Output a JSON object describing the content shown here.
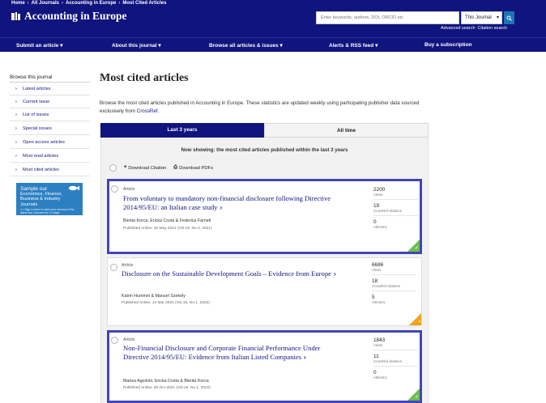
{
  "breadcrumb": [
    "Home",
    "All Journals",
    "Accounting in Europe",
    "Most Cited Articles"
  ],
  "journal": {
    "title": "Accounting in Europe"
  },
  "search": {
    "placeholder": "Enter keywords, authors, DOI, ORCID etc",
    "scope": "This Journal",
    "advanced": "Advanced search",
    "citation": "Citation search"
  },
  "nav": [
    "Submit an article",
    "About this journal",
    "Browse all articles & issues",
    "Alerts & RSS feed",
    "Buy a subscription"
  ],
  "sidebar": {
    "title": "Browse this journal",
    "items": [
      "Latest articles",
      "Current issue",
      "List of issues",
      "Special issues",
      "Open access articles",
      "Most read articles",
      "Most cited articles"
    ],
    "promo": {
      "line1": "Sample our",
      "line2": "Economics, Finance, Business & Industry Journals",
      "line3": ">> Sign in here to start your access to the latest two volumes for 14 days"
    }
  },
  "main": {
    "title": "Most cited articles",
    "intro": "Browse the most cited articles published in Accounting in Europe. These statistics are updated weekly using participating publisher data sourced exclusively from",
    "intro_link": "CrossRef",
    "intro_end": ".",
    "tabs": [
      "Last 3 years",
      "All time"
    ],
    "showing": "Now showing: the most cited articles published within the last 3 years",
    "tools": {
      "download_citation": "Download Citation",
      "download_pdfs": "Download PDFs"
    }
  },
  "articles": [
    {
      "type": "Article",
      "title": "From voluntary to mandatory non-financial disclosure following Directive 2014/95/EU: an Italian case study",
      "authors": "Blerita Korca, Ericka Costa & Federica Farneti",
      "published": "Published online: 30 May 2021 (Vol.18, No.3, 2021)",
      "views": "2200",
      "views_label": "Views",
      "citations": "19",
      "citations_label": "CrossRef citations",
      "altmetric": "0",
      "altmetric_label": "Altmetric",
      "access": "open-access-check",
      "selected": true
    },
    {
      "type": "Article",
      "title": "Disclosure on the Sustainable Development Goals – Evidence from Europe",
      "authors": "Katrin Hummel & Manuel Szekely",
      "published": "Published online: 14 Mar 2021 (Vol.19, No.1, 2022)",
      "views": "6686",
      "views_label": "Views",
      "citations": "18",
      "citations_label": "CrossRef citations",
      "altmetric": "5",
      "altmetric_label": "Altmetric",
      "access": "free-access-lock",
      "selected": false
    },
    {
      "type": "Article",
      "title": "Non-Financial Disclosure and Corporate Financial Performance Under Directive 2014/95/EU: Evidence from Italian Listed Companies",
      "authors": "Marisa Agostini, Ericka Costa & Blerita Korca",
      "published": "Published online: 30 Oct 2021 (Vol.19, No.1, 2022)",
      "views": "1843",
      "views_label": "Views",
      "citations": "11",
      "citations_label": "CrossRef citations",
      "altmetric": "0",
      "altmetric_label": "Altmetric",
      "access": "open-access-check",
      "selected": true
    }
  ],
  "colors": {
    "brand": "#10147e",
    "selection": "#4346b5",
    "open_access": "#6abf4b",
    "free_access": "#f0a31c",
    "promo": "#2c80c1"
  }
}
